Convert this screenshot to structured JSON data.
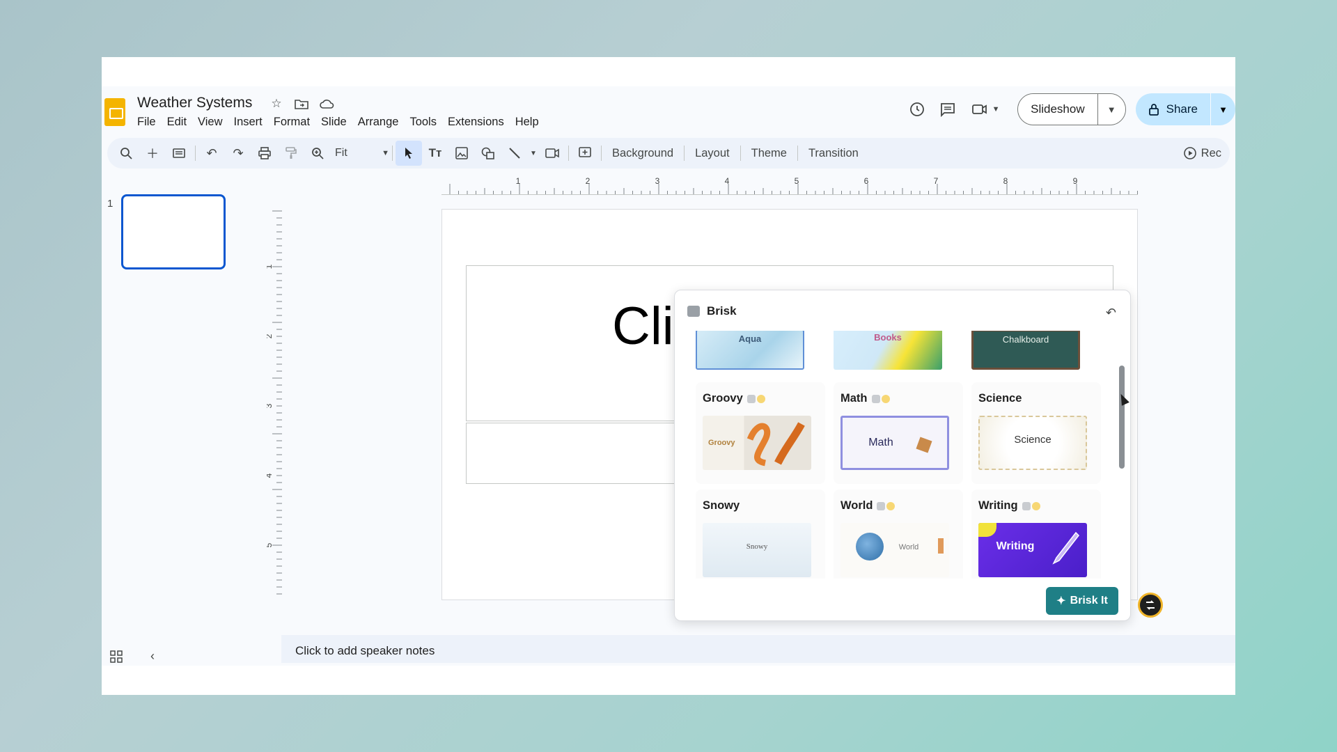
{
  "doc": {
    "title": "Weather Systems"
  },
  "menu": [
    "File",
    "Edit",
    "View",
    "Insert",
    "Format",
    "Slide",
    "Arrange",
    "Tools",
    "Extensions",
    "Help"
  ],
  "header": {
    "slideshow_label": "Slideshow",
    "share_label": "Share"
  },
  "toolbar": {
    "zoom_value": "Fit",
    "background_label": "Background",
    "layout_label": "Layout",
    "theme_label": "Theme",
    "transition_label": "Transition",
    "rec_label": "Rec"
  },
  "filmstrip": {
    "slide_number": "1"
  },
  "ruler": {
    "h_ticks": [
      "1",
      "2",
      "3",
      "4",
      "5",
      "6",
      "7",
      "8",
      "9"
    ],
    "v_ticks": [
      "1",
      "2",
      "3",
      "4",
      "5"
    ]
  },
  "slide": {
    "visible_title_fragment": "Cli"
  },
  "notes": {
    "placeholder": "Click to add speaker notes"
  },
  "brisk": {
    "title": "Brisk",
    "top_row": [
      "Aqua",
      "Books",
      "Chalkboard"
    ],
    "themes": [
      {
        "name": "Groovy",
        "thumb_text": "Groovy"
      },
      {
        "name": "Math",
        "thumb_text": "Math"
      },
      {
        "name": "Science",
        "thumb_text": "Science"
      },
      {
        "name": "Snowy",
        "thumb_text": "Snowy"
      },
      {
        "name": "World",
        "thumb_text": "World"
      },
      {
        "name": "Writing",
        "thumb_text": "Writing"
      }
    ],
    "action_label": "Brisk It"
  },
  "colors": {
    "accent": "#0b57d0",
    "share_bg": "#c2e7ff",
    "brisk_button": "#1f7f86"
  }
}
